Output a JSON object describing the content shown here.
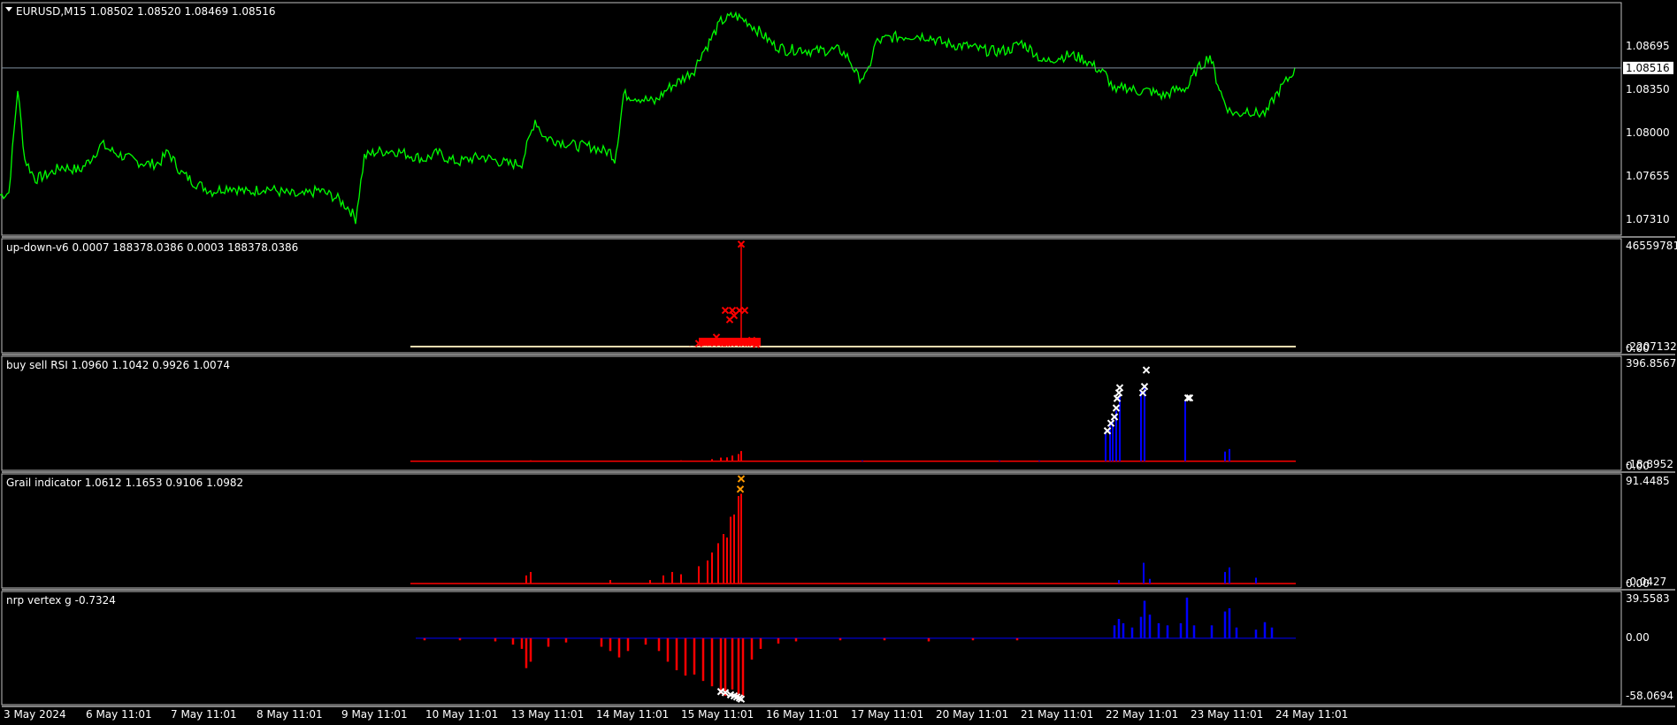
{
  "colors": {
    "background": "#000000",
    "frame": "#c0c0c0",
    "separator": "#808080",
    "price_line": "#00ff00",
    "bid_line": "#7f8fa0",
    "text": "#ffffff",
    "red": "#ff0000",
    "blue": "#0000ff",
    "orange": "#ff9900",
    "white_mark": "#ffffff",
    "baseline": "#f2dcb0"
  },
  "main": {
    "collapse_icon": "triangle-down-icon",
    "header": "EURUSD,M15  1.08502 1.08520 1.08469 1.08516",
    "current_price_tag": "1.08516"
  },
  "x_axis_labels": [
    "3 May 2024",
    "6 May 11:01",
    "7 May 11:01",
    "8 May 11:01",
    "9 May 11:01",
    "10 May 11:01",
    "13 May 11:01",
    "14 May 11:01",
    "15 May 11:01",
    "16 May 11:01",
    "17 May 11:01",
    "20 May 11:01",
    "21 May 11:01",
    "22 May 11:01",
    "23 May 11:01",
    "24 May 11:01"
  ],
  "panes": [
    {
      "id": "main",
      "header": "EURUSD,M15  1.08502 1.08520 1.08469 1.08516",
      "y_labels": [
        "1.08695",
        "1.08350",
        "1.08000",
        "1.07655",
        "1.07310"
      ]
    },
    {
      "id": "updown",
      "header": "up-down-v6 0.0007 188378.0386 0.0003 188378.0386",
      "y_labels": [
        "46559781.",
        "-2207132.4",
        "0.00"
      ]
    },
    {
      "id": "rsi",
      "header": "buy sell RSI 1.0960 1.1042 0.9926 1.0074",
      "y_labels": [
        "396.8567",
        "-18.8952",
        "0.00"
      ]
    },
    {
      "id": "grail",
      "header": "Grail indicator 1.0612 1.1653 0.9106 1.0982",
      "y_labels": [
        "91.4485",
        "-0.0427",
        "0.00"
      ]
    },
    {
      "id": "nrp",
      "header": "nrp vertex g -0.7324",
      "y_labels": [
        "39.5583",
        "0.00",
        "-58.0694"
      ]
    }
  ],
  "chart_data": [
    {
      "type": "line",
      "title": "EURUSD,M15",
      "x": [
        "3 May 2024",
        "6 May 11:01",
        "7 May 11:01",
        "8 May 11:01",
        "9 May 11:01",
        "10 May 11:01",
        "13 May 11:01",
        "14 May 11:01",
        "15 May 11:01",
        "16 May 11:01",
        "17 May 11:01",
        "20 May 11:01",
        "21 May 11:01",
        "22 May 11:01",
        "23 May 11:01",
        "24 May 11:01"
      ],
      "ylim": [
        1.0721,
        1.09
      ],
      "path": [
        [
          0,
          1.0749
        ],
        [
          10,
          1.0751
        ],
        [
          20,
          1.0835
        ],
        [
          28,
          1.0778
        ],
        [
          40,
          1.0762
        ],
        [
          55,
          1.0766
        ],
        [
          70,
          1.0772
        ],
        [
          90,
          1.0769
        ],
        [
          100,
          1.0776
        ],
        [
          115,
          1.079
        ],
        [
          125,
          1.0785
        ],
        [
          140,
          1.078
        ],
        [
          155,
          1.0776
        ],
        [
          170,
          1.0774
        ],
        [
          180,
          1.0775
        ],
        [
          190,
          1.0784
        ],
        [
          205,
          1.0767
        ],
        [
          220,
          1.0759
        ],
        [
          240,
          1.0752
        ],
        [
          260,
          1.0756
        ],
        [
          280,
          1.0751
        ],
        [
          300,
          1.0755
        ],
        [
          320,
          1.0751
        ],
        [
          340,
          1.0748
        ],
        [
          360,
          1.0753
        ],
        [
          380,
          1.0747
        ],
        [
          395,
          1.0738
        ],
        [
          402,
          1.073
        ],
        [
          412,
          1.078
        ],
        [
          425,
          1.0784
        ],
        [
          445,
          1.0785
        ],
        [
          465,
          1.0781
        ],
        [
          480,
          1.0778
        ],
        [
          495,
          1.0783
        ],
        [
          510,
          1.0777
        ],
        [
          520,
          1.0776
        ],
        [
          530,
          1.0778
        ],
        [
          545,
          1.078
        ],
        [
          560,
          1.0777
        ],
        [
          575,
          1.0774
        ],
        [
          590,
          1.0775
        ],
        [
          605,
          1.081
        ],
        [
          615,
          1.0796
        ],
        [
          630,
          1.0793
        ],
        [
          650,
          1.0789
        ],
        [
          670,
          1.0788
        ],
        [
          680,
          1.0785
        ],
        [
          690,
          1.0784
        ],
        [
          695,
          1.0778
        ],
        [
          700,
          1.0801
        ],
        [
          705,
          1.083
        ],
        [
          720,
          1.0828
        ],
        [
          740,
          1.0824
        ],
        [
          755,
          1.0835
        ],
        [
          770,
          1.0842
        ],
        [
          785,
          1.085
        ],
        [
          792,
          1.0862
        ],
        [
          800,
          1.087
        ],
        [
          815,
          1.0889
        ],
        [
          830,
          1.0894
        ],
        [
          845,
          1.0889
        ],
        [
          860,
          1.088
        ],
        [
          875,
          1.087
        ],
        [
          890,
          1.0866
        ],
        [
          905,
          1.0867
        ],
        [
          920,
          1.0865
        ],
        [
          935,
          1.0866
        ],
        [
          950,
          1.0866
        ],
        [
          960,
          1.0859
        ],
        [
          970,
          1.0844
        ],
        [
          980,
          1.0845
        ],
        [
          990,
          1.0872
        ],
        [
          1005,
          1.0876
        ],
        [
          1020,
          1.0877
        ],
        [
          1035,
          1.0878
        ],
        [
          1050,
          1.0877
        ],
        [
          1065,
          1.0872
        ],
        [
          1080,
          1.087
        ],
        [
          1095,
          1.0869
        ],
        [
          1110,
          1.0866
        ],
        [
          1125,
          1.0865
        ],
        [
          1140,
          1.0866
        ],
        [
          1155,
          1.0872
        ],
        [
          1170,
          1.0864
        ],
        [
          1180,
          1.0856
        ],
        [
          1195,
          1.086
        ],
        [
          1210,
          1.0862
        ],
        [
          1225,
          1.0859
        ],
        [
          1235,
          1.0854
        ],
        [
          1250,
          1.0846
        ],
        [
          1262,
          1.0831
        ],
        [
          1270,
          1.0837
        ],
        [
          1285,
          1.0833
        ],
        [
          1300,
          1.0833
        ],
        [
          1315,
          1.0829
        ],
        [
          1330,
          1.0834
        ],
        [
          1343,
          1.0836
        ],
        [
          1352,
          1.0849
        ],
        [
          1360,
          1.0855
        ],
        [
          1368,
          1.0862
        ],
        [
          1375,
          1.0843
        ],
        [
          1382,
          1.0828
        ],
        [
          1390,
          1.0817
        ],
        [
          1400,
          1.0814
        ],
        [
          1410,
          1.0818
        ],
        [
          1420,
          1.0815
        ],
        [
          1432,
          1.0815
        ],
        [
          1440,
          1.0827
        ],
        [
          1450,
          1.0837
        ],
        [
          1458,
          1.0844
        ],
        [
          1464,
          1.0852
        ]
      ],
      "current_price": 1.08516
    },
    {
      "type": "bar",
      "title": "up-down-v6",
      "ylim": [
        -2207132.4,
        46559781
      ],
      "series": [
        {
          "values": [
            [
              780,
              0.25
            ],
            [
              785,
              0.3
            ],
            [
              790,
              0.28
            ],
            [
              795,
              0.35
            ],
            [
              800,
              0.4
            ],
            [
              805,
              1.2
            ],
            [
              810,
              1.0
            ],
            [
              815,
              1.4
            ],
            [
              818,
              1.3
            ],
            [
              820,
              4.3
            ],
            [
              823,
              1.0
            ],
            [
              826,
              1.0
            ],
            [
              830,
              1.6
            ],
            [
              835,
              4.3
            ],
            [
              838,
              99.0
            ],
            [
              842,
              1.2
            ],
            [
              845,
              4.2
            ],
            [
              848,
              0.9
            ],
            [
              852,
              0.6
            ],
            [
              855,
              0.5
            ],
            [
              860,
              0.3
            ]
          ]
        }
      ],
      "markers": [
        [
          838,
          99.0
        ],
        [
          820,
          35.0
        ],
        [
          828,
          35.0
        ],
        [
          836,
          35.0
        ],
        [
          842,
          35.0
        ],
        [
          830,
          30.0
        ],
        [
          825,
          26.0
        ],
        [
          810,
          9.0
        ],
        [
          800,
          4.0
        ],
        [
          790,
          3.0
        ],
        [
          850,
          6.0
        ],
        [
          855,
          2.0
        ]
      ]
    },
    {
      "type": "bar",
      "title": "buy sell RSI",
      "ylim": [
        -18.8952,
        396.8567
      ],
      "series": [
        {
          "name": "red",
          "values": [
            [
              600,
              3.0
            ],
            [
              770,
              3.0
            ],
            [
              805,
              8.0
            ],
            [
              815,
              14.0
            ],
            [
              822,
              15.0
            ],
            [
              828,
              22.0
            ],
            [
              835,
              28.0
            ],
            [
              838,
              40.0
            ]
          ]
        },
        {
          "name": "blue",
          "values": [
            [
              975,
              3.0
            ],
            [
              1130,
              3.0
            ],
            [
              1175,
              3.0
            ],
            [
              1250,
              118.0
            ],
            [
              1255,
              150.0
            ],
            [
              1258,
              170.0
            ],
            [
              1262,
              200.0
            ],
            [
              1266,
              260.0
            ],
            [
              1290,
              280.0
            ],
            [
              1294,
              300.0
            ],
            [
              1340,
              238.0
            ],
            [
              1385,
              38.0
            ],
            [
              1390,
              48.0
            ]
          ]
        }
      ],
      "markers": [
        [
          1252,
          120.0
        ],
        [
          1256,
          150.0
        ],
        [
          1260,
          175.0
        ],
        [
          1262,
          210.0
        ],
        [
          1263,
          248.0
        ],
        [
          1265,
          270.0
        ],
        [
          1266,
          290.0
        ],
        [
          1292,
          270.0
        ],
        [
          1294,
          295.0
        ],
        [
          1296,
          360.0
        ],
        [
          1343,
          250.0
        ],
        [
          1345,
          250.0
        ]
      ]
    },
    {
      "type": "bar",
      "title": "Grail indicator",
      "ylim": [
        -0.0427,
        91.4485
      ],
      "series": [
        {
          "name": "red",
          "values": [
            [
              595,
              7.0
            ],
            [
              600,
              10.0
            ],
            [
              690,
              3.0
            ],
            [
              735,
              3.0
            ],
            [
              750,
              7.0
            ],
            [
              760,
              10.0
            ],
            [
              770,
              8.0
            ],
            [
              790,
              15.0
            ],
            [
              800,
              20.0
            ],
            [
              805,
              27.0
            ],
            [
              812,
              35.0
            ],
            [
              818,
              43.0
            ],
            [
              822,
              40.0
            ],
            [
              826,
              58.0
            ],
            [
              830,
              60.0
            ],
            [
              835,
              76.0
            ],
            [
              838,
              78.0
            ]
          ]
        },
        {
          "name": "blue",
          "values": [
            [
              1265,
              3.0
            ],
            [
              1293,
              18.0
            ],
            [
              1300,
              4.0
            ],
            [
              1385,
              10.0
            ],
            [
              1390,
              14.0
            ],
            [
              1420,
              5.0
            ]
          ]
        }
      ],
      "markers": [
        [
          837,
          82.0
        ],
        [
          838,
          91.0
        ]
      ]
    },
    {
      "type": "bar",
      "title": "nrp vertex g",
      "ylim": [
        -58.0694,
        39.5583
      ],
      "series": [
        {
          "name": "negative",
          "values": [
            [
              480,
              -2.0
            ],
            [
              520,
              -2.0
            ],
            [
              560,
              -3.0
            ],
            [
              580,
              -6.0
            ],
            [
              590,
              -10.0
            ],
            [
              595,
              -28.0
            ],
            [
              600,
              -22.0
            ],
            [
              620,
              -8.0
            ],
            [
              640,
              -4.0
            ],
            [
              680,
              -8.0
            ],
            [
              690,
              -12.0
            ],
            [
              700,
              -18.0
            ],
            [
              710,
              -12.0
            ],
            [
              730,
              -6.0
            ],
            [
              745,
              -12.0
            ],
            [
              755,
              -22.0
            ],
            [
              765,
              -30.0
            ],
            [
              775,
              -35.0
            ],
            [
              785,
              -34.0
            ],
            [
              795,
              -40.0
            ],
            [
              805,
              -45.0
            ],
            [
              815,
              -52.0
            ],
            [
              820,
              -54.0
            ],
            [
              828,
              -48.0
            ],
            [
              835,
              -58.0
            ],
            [
              840,
              -54.0
            ],
            [
              850,
              -20.0
            ],
            [
              860,
              -10.0
            ],
            [
              880,
              -5.0
            ],
            [
              900,
              -3.0
            ],
            [
              950,
              -2.0
            ],
            [
              1000,
              -2.0
            ],
            [
              1050,
              -3.0
            ],
            [
              1100,
              -2.0
            ],
            [
              1150,
              -2.0
            ]
          ]
        },
        {
          "name": "positive",
          "values": [
            [
              1260,
              12.0
            ],
            [
              1265,
              18.0
            ],
            [
              1270,
              14.0
            ],
            [
              1280,
              10.0
            ],
            [
              1290,
              20.0
            ],
            [
              1294,
              35.0
            ],
            [
              1300,
              22.0
            ],
            [
              1310,
              14.0
            ],
            [
              1320,
              12.0
            ],
            [
              1335,
              14.0
            ],
            [
              1342,
              38.0
            ],
            [
              1350,
              12.0
            ],
            [
              1370,
              12.0
            ],
            [
              1385,
              25.0
            ],
            [
              1390,
              28.0
            ],
            [
              1398,
              10.0
            ],
            [
              1420,
              8.0
            ],
            [
              1430,
              15.0
            ],
            [
              1438,
              10.0
            ]
          ]
        }
      ],
      "markers": [
        [
          815,
          -50.0
        ],
        [
          820,
          -51.0
        ],
        [
          826,
          -53.0
        ],
        [
          830,
          -54.0
        ],
        [
          833,
          -55.0
        ],
        [
          836,
          -56.0
        ],
        [
          838,
          -57.0
        ]
      ]
    }
  ]
}
